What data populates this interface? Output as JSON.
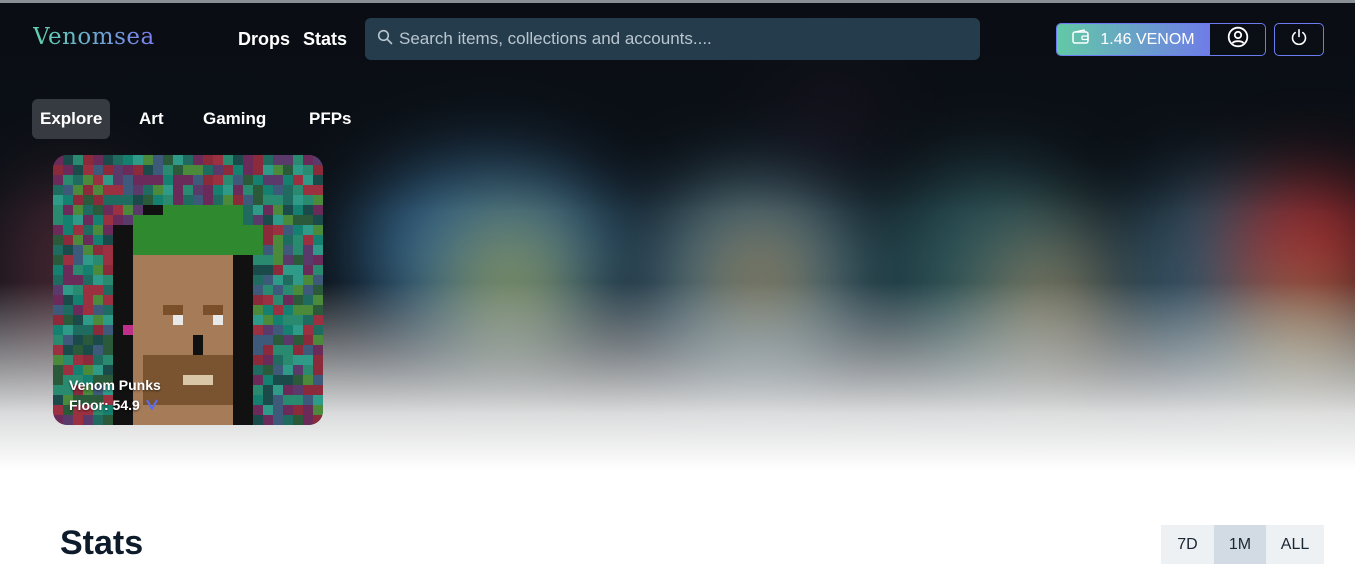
{
  "header": {
    "logo_text": "Venomsea",
    "nav": {
      "drops": "Drops",
      "stats": "Stats"
    },
    "search": {
      "placeholder": "Search items, collections and accounts....",
      "value": ""
    },
    "wallet": {
      "balance": "1.46 VENOM",
      "wallet_icon": "wallet-icon",
      "profile_icon": "user-circle-icon"
    },
    "power_icon": "power-icon"
  },
  "tabs": [
    {
      "label": "Explore",
      "active": true
    },
    {
      "label": "Art",
      "active": false
    },
    {
      "label": "Gaming",
      "active": false
    },
    {
      "label": "PFPs",
      "active": false
    }
  ],
  "featured": {
    "name": "Venom Punks",
    "floor": "Floor: 54.9",
    "currency_icon": "venom-logo-icon"
  },
  "stats": {
    "title": "Stats",
    "periods": [
      {
        "label": "7D",
        "active": false
      },
      {
        "label": "1M",
        "active": true
      },
      {
        "label": "ALL",
        "active": false
      }
    ]
  },
  "colors": {
    "accent_gradient_start": "#62c9a6",
    "accent_gradient_end": "#6f7ce8",
    "dark_text": "#0d1b2a"
  }
}
